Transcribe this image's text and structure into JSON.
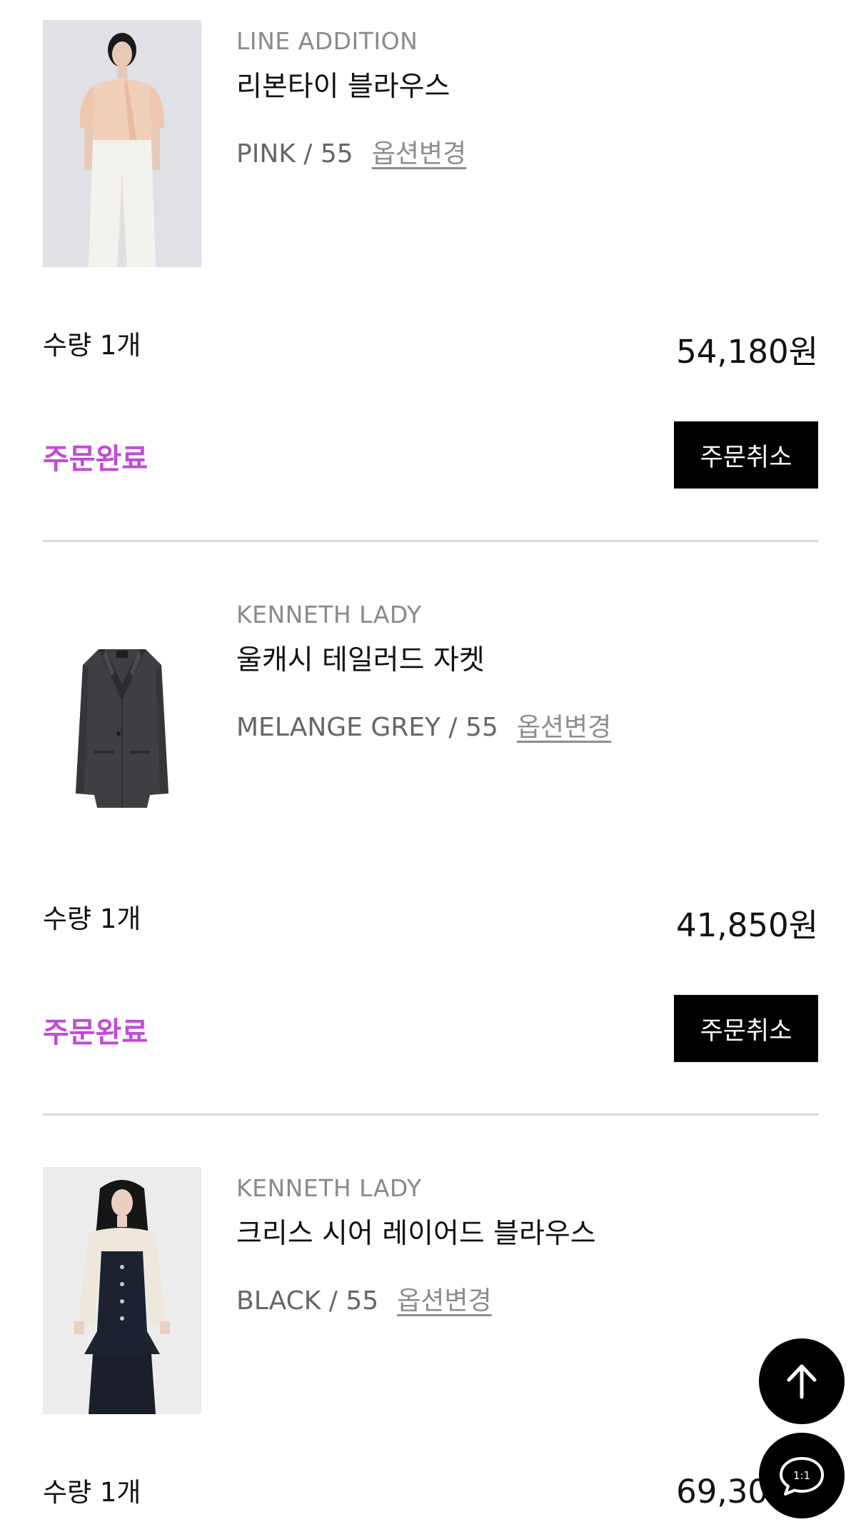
{
  "items": [
    {
      "brand": "LINE ADDITION",
      "name": "리본타이 블라우스",
      "option": "PINK / 55",
      "option_change": "옵션변경",
      "quantity": "수량 1개",
      "price": "54,180원",
      "status": "주문완료",
      "cancel_label": "주문취소"
    },
    {
      "brand": "KENNETH LADY",
      "name": "울캐시 테일러드 자켓",
      "option": "MELANGE GREY / 55",
      "option_change": "옵션변경",
      "quantity": "수량 1개",
      "price": "41,850원",
      "status": "주문완료",
      "cancel_label": "주문취소"
    },
    {
      "brand": "KENNETH LADY",
      "name": "크리스 시어 레이어드 블라우스",
      "option": "BLACK / 55",
      "option_change": "옵션변경",
      "quantity": "수량 1개",
      "price": "69,30"
    }
  ],
  "fab": {
    "top_icon": "arrow-up-icon",
    "chat_icon": "chat-bubble-icon",
    "chat_text": "1:1"
  },
  "colors": {
    "status": "#c14ad6",
    "button_bg": "#000000",
    "divider": "#d9d9d9"
  }
}
